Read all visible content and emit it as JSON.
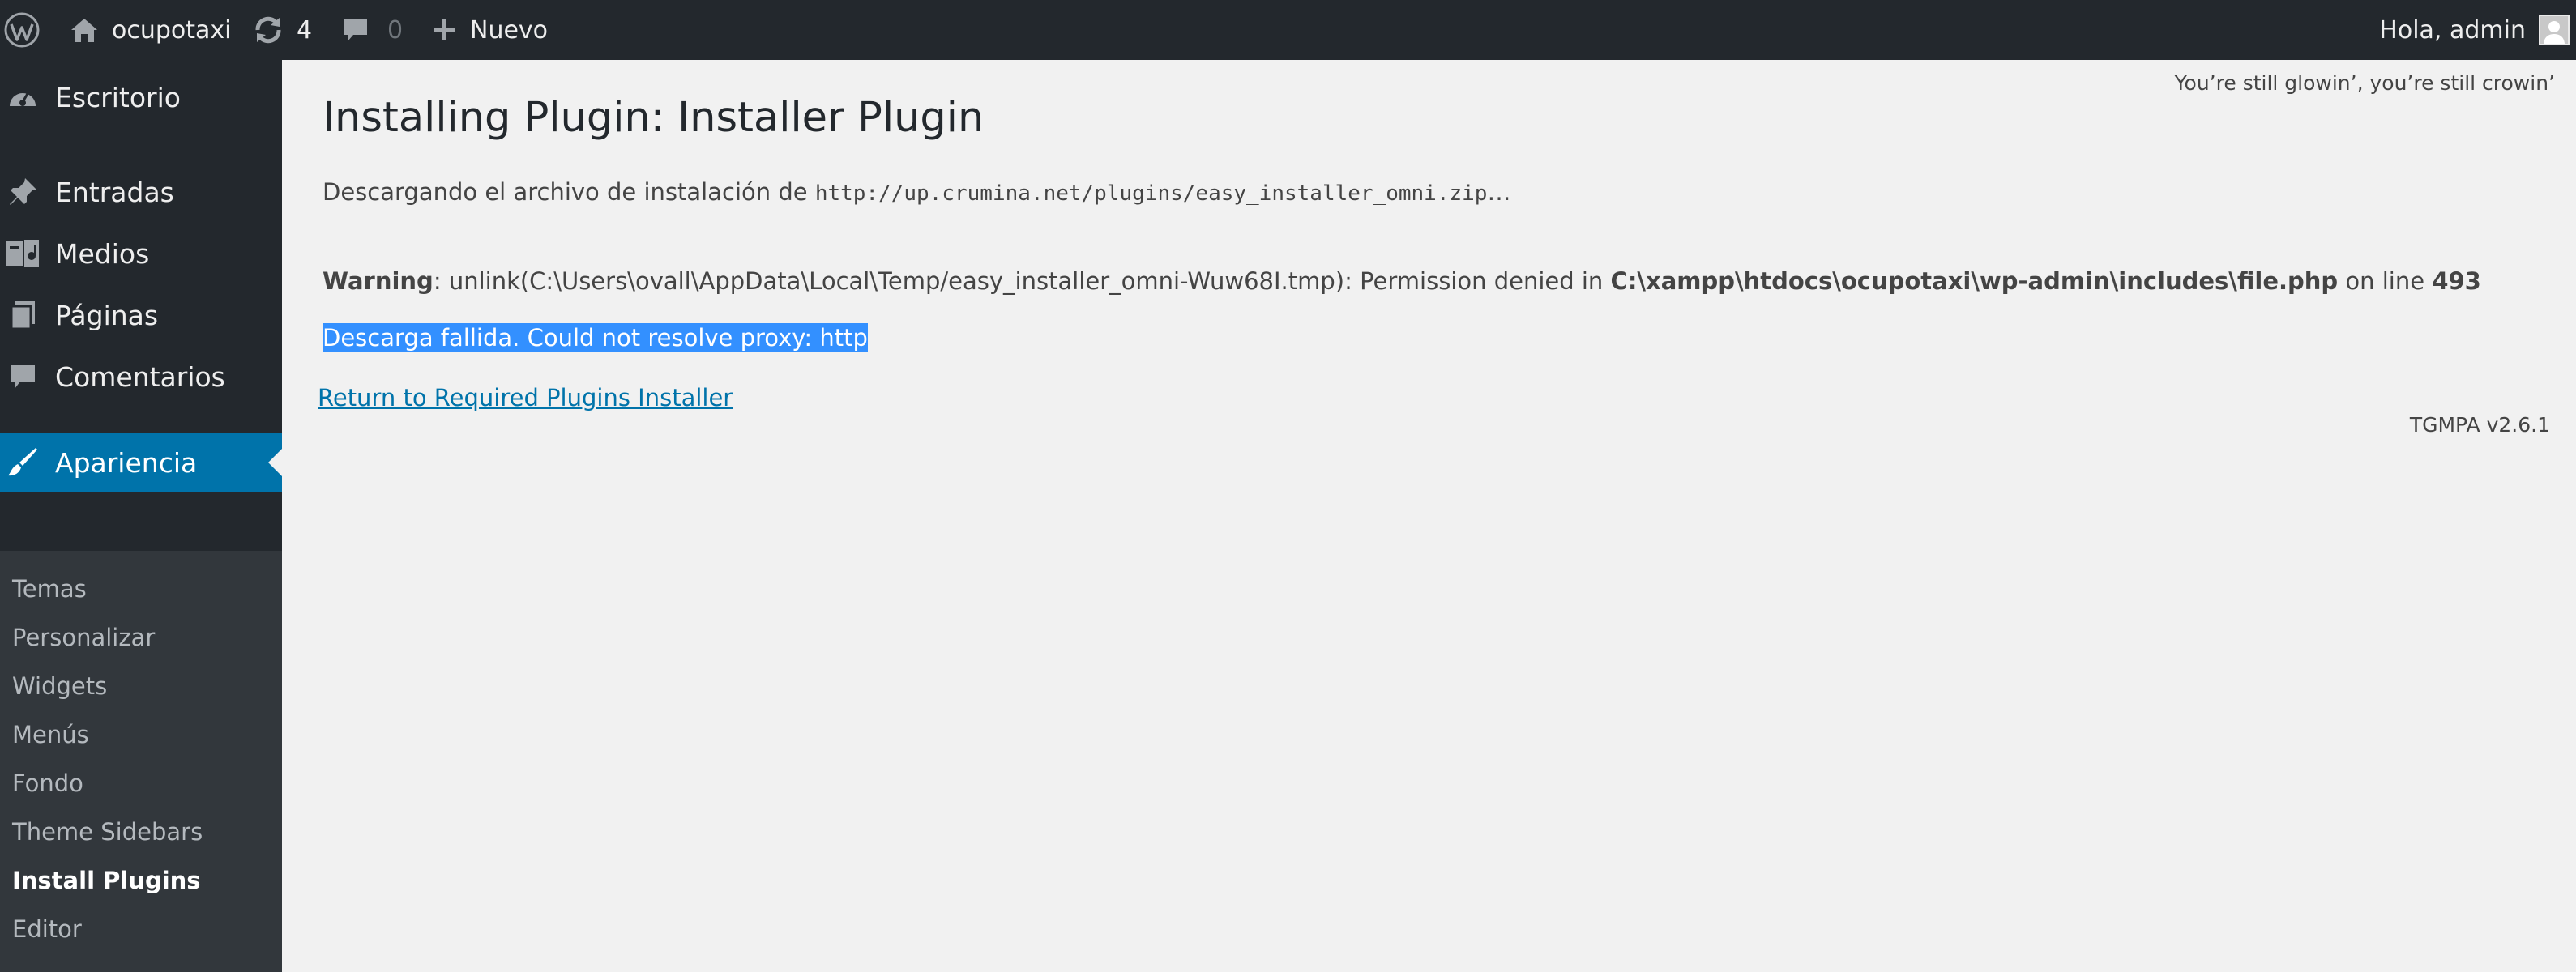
{
  "adminbar": {
    "site_name": "ocupotaxi",
    "updates_count": "4",
    "comments_count": "0",
    "new_label": "Nuevo",
    "greeting": "Hola, admin"
  },
  "sidebar": {
    "items": [
      {
        "label": "Escritorio",
        "icon": "dashboard-icon"
      },
      {
        "label": "Entradas",
        "icon": "pushpin-icon"
      },
      {
        "label": "Medios",
        "icon": "media-icon"
      },
      {
        "label": "Páginas",
        "icon": "pages-icon"
      },
      {
        "label": "Comentarios",
        "icon": "comment-icon"
      },
      {
        "label": "Apariencia",
        "icon": "paintbrush-icon"
      }
    ],
    "submenu": [
      {
        "label": "Temas"
      },
      {
        "label": "Personalizar"
      },
      {
        "label": "Widgets"
      },
      {
        "label": "Menús"
      },
      {
        "label": "Fondo"
      },
      {
        "label": "Theme Sidebars"
      },
      {
        "label": "Install Plugins"
      },
      {
        "label": "Editor"
      }
    ]
  },
  "content": {
    "dolly": "You’re still glowin’, you’re still crowin’",
    "title": "Installing Plugin: Installer Plugin",
    "download_prefix": "Descargando el archivo de instalación de",
    "download_url": "http://up.crumina.net/plugins/easy_installer_omni.zip",
    "download_suffix": "…",
    "warning_label": "Warning",
    "warning_text": ": unlink(C:\\Users\\ovall\\AppData\\Local\\Temp/easy_installer_omni-Wuw68I.tmp): Permission denied in",
    "warning_file": "C:\\xampp\\htdocs\\ocupotaxi\\wp-admin\\includes\\file.php",
    "warning_online": "on line",
    "warning_line": "493",
    "failed_message": "Descarga fallida. Could not resolve proxy: http",
    "return_link": "Return to Required Plugins Installer",
    "tgmpa_version": "TGMPA v2.6.1"
  },
  "colors": {
    "adminbar_bg": "#23282d",
    "sidebar_bg": "#23282d",
    "submenu_bg": "#32373c",
    "current_bg": "#0073aa",
    "content_bg": "#f1f1f1",
    "link": "#0073aa",
    "selection": "#3390ff"
  }
}
